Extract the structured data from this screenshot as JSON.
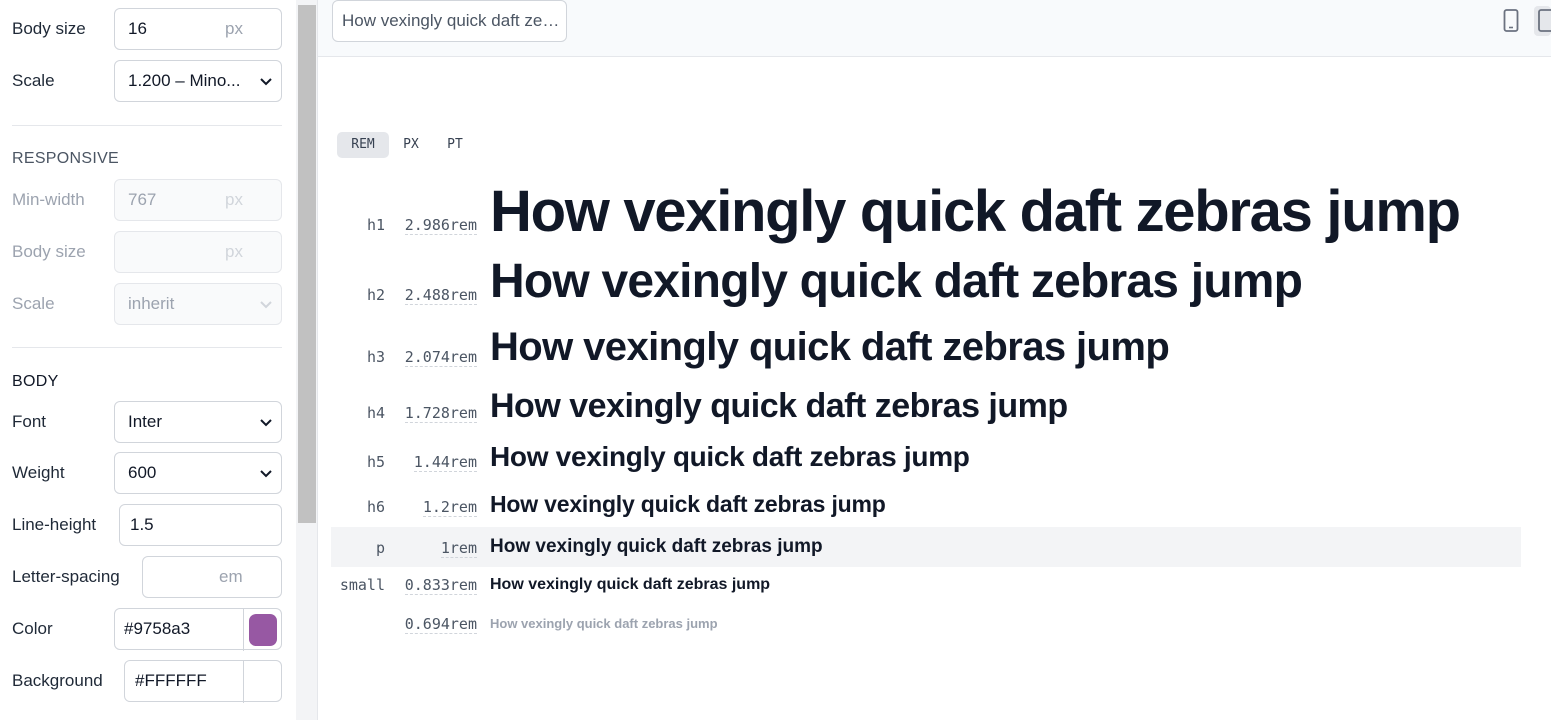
{
  "sidebar": {
    "body_size": {
      "label": "Body size",
      "value": "16",
      "unit": "px"
    },
    "scale": {
      "label": "Scale",
      "value": "1.200 – Mino..."
    },
    "responsive": {
      "title": "RESPONSIVE",
      "min_width": {
        "label": "Min-width",
        "value": "767",
        "unit": "px"
      },
      "body_size": {
        "label": "Body size",
        "value": "",
        "unit": "px"
      },
      "scale": {
        "label": "Scale",
        "value": "inherit"
      }
    },
    "body": {
      "title": "BODY",
      "font": {
        "label": "Font",
        "value": "Inter"
      },
      "weight": {
        "label": "Weight",
        "value": "600"
      },
      "line_height": {
        "label": "Line-height",
        "value": "1.5"
      },
      "letter_spacing": {
        "label": "Letter-spacing",
        "value": "",
        "unit": "em"
      },
      "color": {
        "label": "Color",
        "value": "#9758a3",
        "swatch": "#9758a3"
      },
      "background": {
        "label": "Background",
        "value": "#FFFFFF",
        "swatch": "#FFFFFF"
      }
    }
  },
  "topbar": {
    "preview_text": "How vexingly quick daft zebras jump",
    "icons": [
      "mobile-device-icon",
      "tablet-device-icon"
    ]
  },
  "unit_tabs": [
    {
      "label": "REM",
      "active": true
    },
    {
      "label": "PX",
      "active": false
    },
    {
      "label": "PT",
      "active": false
    }
  ],
  "scale_rows": [
    {
      "tag": "h1",
      "size": "2.986rem",
      "text": "How vexingly quick daft zebras jump"
    },
    {
      "tag": "h2",
      "size": "2.488rem",
      "text": "How vexingly quick daft zebras jump"
    },
    {
      "tag": "h3",
      "size": "2.074rem",
      "text": "How vexingly quick daft zebras jump"
    },
    {
      "tag": "h4",
      "size": "1.728rem",
      "text": "How vexingly quick daft zebras jump"
    },
    {
      "tag": "h5",
      "size": "1.44rem",
      "text": "How vexingly quick daft zebras jump"
    },
    {
      "tag": "h6",
      "size": "1.2rem",
      "text": "How vexingly quick daft zebras jump"
    },
    {
      "tag": "p",
      "size": "1rem",
      "text": "How vexingly quick daft zebras jump"
    },
    {
      "tag": "small",
      "size": "0.833rem",
      "text": "How vexingly quick daft zebras jump"
    },
    {
      "tag": "",
      "size": "0.694rem",
      "text": "How vexingly quick daft zebras jump"
    }
  ],
  "colors": {
    "text": "#111827",
    "muted": "#9ca3af",
    "accent": "#9758a3"
  }
}
